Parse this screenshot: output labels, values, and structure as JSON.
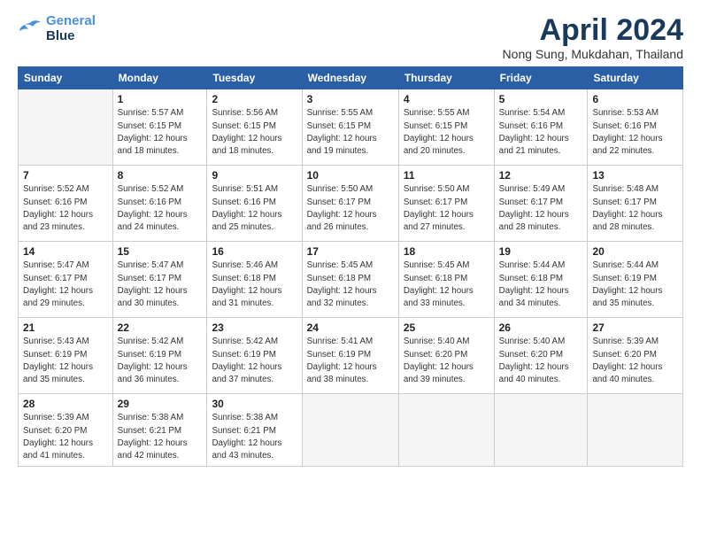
{
  "logo": {
    "line1": "General",
    "line2": "Blue"
  },
  "title": "April 2024",
  "location": "Nong Sung, Mukdahan, Thailand",
  "weekdays": [
    "Sunday",
    "Monday",
    "Tuesday",
    "Wednesday",
    "Thursday",
    "Friday",
    "Saturday"
  ],
  "weeks": [
    [
      {
        "day": "",
        "info": ""
      },
      {
        "day": "1",
        "info": "Sunrise: 5:57 AM\nSunset: 6:15 PM\nDaylight: 12 hours\nand 18 minutes."
      },
      {
        "day": "2",
        "info": "Sunrise: 5:56 AM\nSunset: 6:15 PM\nDaylight: 12 hours\nand 18 minutes."
      },
      {
        "day": "3",
        "info": "Sunrise: 5:55 AM\nSunset: 6:15 PM\nDaylight: 12 hours\nand 19 minutes."
      },
      {
        "day": "4",
        "info": "Sunrise: 5:55 AM\nSunset: 6:15 PM\nDaylight: 12 hours\nand 20 minutes."
      },
      {
        "day": "5",
        "info": "Sunrise: 5:54 AM\nSunset: 6:16 PM\nDaylight: 12 hours\nand 21 minutes."
      },
      {
        "day": "6",
        "info": "Sunrise: 5:53 AM\nSunset: 6:16 PM\nDaylight: 12 hours\nand 22 minutes."
      }
    ],
    [
      {
        "day": "7",
        "info": "Sunrise: 5:52 AM\nSunset: 6:16 PM\nDaylight: 12 hours\nand 23 minutes."
      },
      {
        "day": "8",
        "info": "Sunrise: 5:52 AM\nSunset: 6:16 PM\nDaylight: 12 hours\nand 24 minutes."
      },
      {
        "day": "9",
        "info": "Sunrise: 5:51 AM\nSunset: 6:16 PM\nDaylight: 12 hours\nand 25 minutes."
      },
      {
        "day": "10",
        "info": "Sunrise: 5:50 AM\nSunset: 6:17 PM\nDaylight: 12 hours\nand 26 minutes."
      },
      {
        "day": "11",
        "info": "Sunrise: 5:50 AM\nSunset: 6:17 PM\nDaylight: 12 hours\nand 27 minutes."
      },
      {
        "day": "12",
        "info": "Sunrise: 5:49 AM\nSunset: 6:17 PM\nDaylight: 12 hours\nand 28 minutes."
      },
      {
        "day": "13",
        "info": "Sunrise: 5:48 AM\nSunset: 6:17 PM\nDaylight: 12 hours\nand 28 minutes."
      }
    ],
    [
      {
        "day": "14",
        "info": "Sunrise: 5:47 AM\nSunset: 6:17 PM\nDaylight: 12 hours\nand 29 minutes."
      },
      {
        "day": "15",
        "info": "Sunrise: 5:47 AM\nSunset: 6:17 PM\nDaylight: 12 hours\nand 30 minutes."
      },
      {
        "day": "16",
        "info": "Sunrise: 5:46 AM\nSunset: 6:18 PM\nDaylight: 12 hours\nand 31 minutes."
      },
      {
        "day": "17",
        "info": "Sunrise: 5:45 AM\nSunset: 6:18 PM\nDaylight: 12 hours\nand 32 minutes."
      },
      {
        "day": "18",
        "info": "Sunrise: 5:45 AM\nSunset: 6:18 PM\nDaylight: 12 hours\nand 33 minutes."
      },
      {
        "day": "19",
        "info": "Sunrise: 5:44 AM\nSunset: 6:18 PM\nDaylight: 12 hours\nand 34 minutes."
      },
      {
        "day": "20",
        "info": "Sunrise: 5:44 AM\nSunset: 6:19 PM\nDaylight: 12 hours\nand 35 minutes."
      }
    ],
    [
      {
        "day": "21",
        "info": "Sunrise: 5:43 AM\nSunset: 6:19 PM\nDaylight: 12 hours\nand 35 minutes."
      },
      {
        "day": "22",
        "info": "Sunrise: 5:42 AM\nSunset: 6:19 PM\nDaylight: 12 hours\nand 36 minutes."
      },
      {
        "day": "23",
        "info": "Sunrise: 5:42 AM\nSunset: 6:19 PM\nDaylight: 12 hours\nand 37 minutes."
      },
      {
        "day": "24",
        "info": "Sunrise: 5:41 AM\nSunset: 6:19 PM\nDaylight: 12 hours\nand 38 minutes."
      },
      {
        "day": "25",
        "info": "Sunrise: 5:40 AM\nSunset: 6:20 PM\nDaylight: 12 hours\nand 39 minutes."
      },
      {
        "day": "26",
        "info": "Sunrise: 5:40 AM\nSunset: 6:20 PM\nDaylight: 12 hours\nand 40 minutes."
      },
      {
        "day": "27",
        "info": "Sunrise: 5:39 AM\nSunset: 6:20 PM\nDaylight: 12 hours\nand 40 minutes."
      }
    ],
    [
      {
        "day": "28",
        "info": "Sunrise: 5:39 AM\nSunset: 6:20 PM\nDaylight: 12 hours\nand 41 minutes."
      },
      {
        "day": "29",
        "info": "Sunrise: 5:38 AM\nSunset: 6:21 PM\nDaylight: 12 hours\nand 42 minutes."
      },
      {
        "day": "30",
        "info": "Sunrise: 5:38 AM\nSunset: 6:21 PM\nDaylight: 12 hours\nand 43 minutes."
      },
      {
        "day": "",
        "info": ""
      },
      {
        "day": "",
        "info": ""
      },
      {
        "day": "",
        "info": ""
      },
      {
        "day": "",
        "info": ""
      }
    ]
  ]
}
